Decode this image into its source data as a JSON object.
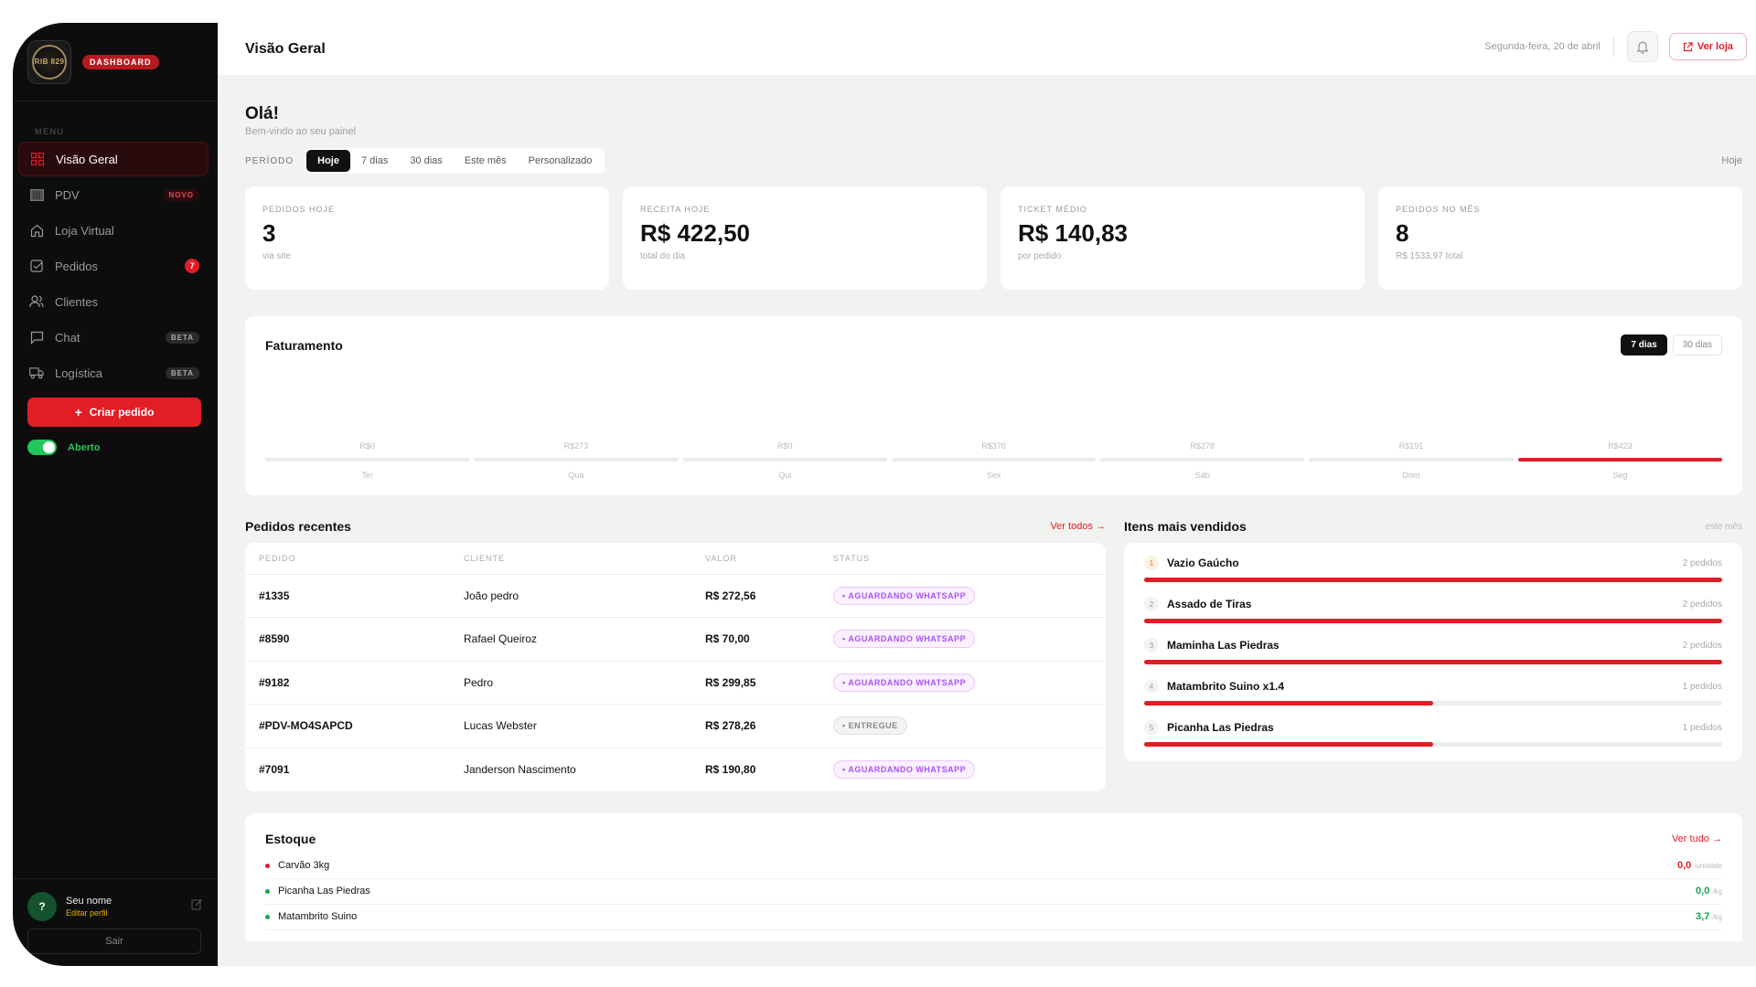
{
  "brand": {
    "logo_text": "RIB 829",
    "badge": "DASHBOARD"
  },
  "sidebar": {
    "menu_label": "MENU",
    "items": [
      {
        "label": "Visão Geral",
        "icon": "grid-icon",
        "active": true
      },
      {
        "label": "PDV",
        "icon": "register-icon",
        "badge": "NOVO"
      },
      {
        "label": "Loja Virtual",
        "icon": "home-icon"
      },
      {
        "label": "Pedidos",
        "icon": "checklist-icon",
        "count": "7"
      },
      {
        "label": "Clientes",
        "icon": "users-icon"
      },
      {
        "label": "Chat",
        "icon": "chat-icon",
        "badge": "BETA"
      },
      {
        "label": "Logística",
        "icon": "truck-icon",
        "badge": "BETA"
      }
    ],
    "create_order": "Criar pedido",
    "store_status": "Aberto",
    "user": {
      "avatar": "?",
      "name": "Seu nome",
      "edit": "Editar perfil"
    },
    "logout": "Sair"
  },
  "header": {
    "title": "Visão Geral",
    "date": "Segunda-feira, 20 de abril",
    "view_store": "Ver loja"
  },
  "greeting": {
    "title": "Olá!",
    "subtitle": "Bem-vindo ao seu painel"
  },
  "period": {
    "label": "PERÍODO",
    "options": [
      "Hoje",
      "7 dias",
      "30 dias",
      "Este mês",
      "Personalizado"
    ],
    "selected": "Hoje",
    "current": "Hoje"
  },
  "stats": [
    {
      "label": "PEDIDOS HOJE",
      "value": "3",
      "sub": "via site"
    },
    {
      "label": "RECEITA HOJE",
      "value": "R$ 422,50",
      "sub": "total do dia"
    },
    {
      "label": "TICKET MÉDIO",
      "value": "R$ 140,83",
      "sub": "por pedido"
    },
    {
      "label": "PEDIDOS NO MÊS",
      "value": "8",
      "sub": "R$ 1533,97 total"
    }
  ],
  "revenue": {
    "title": "Faturamento",
    "range_options": [
      "7 dias",
      "30 dias"
    ],
    "range_selected": "7 dias"
  },
  "chart_data": {
    "type": "bar",
    "categories": [
      "Ter",
      "Qua",
      "Qui",
      "Sex",
      "Sáb",
      "Dom",
      "Seg"
    ],
    "value_labels": [
      "R$0",
      "R$273",
      "R$0",
      "R$370",
      "R$278",
      "R$191",
      "R$423"
    ],
    "values": [
      0,
      273,
      0,
      370,
      278,
      191,
      423
    ],
    "highlight_color": "#e11d26",
    "highlight_index": 6,
    "title": "Faturamento"
  },
  "orders": {
    "title": "Pedidos recentes",
    "view_all": "Ver todos →",
    "columns": [
      "PEDIDO",
      "CLIENTE",
      "VALOR",
      "STATUS"
    ],
    "rows": [
      {
        "id": "#1335",
        "client": "João pedro",
        "value": "R$ 272,56",
        "status": "• AGUARDANDO WHATSAPP",
        "kind": "wait"
      },
      {
        "id": "#8590",
        "client": "Rafael Queiroz",
        "value": "R$ 70,00",
        "status": "• AGUARDANDO WHATSAPP",
        "kind": "wait"
      },
      {
        "id": "#9182",
        "client": "Pedro",
        "value": "R$ 299,85",
        "status": "• AGUARDANDO WHATSAPP",
        "kind": "wait"
      },
      {
        "id": "#PDV-MO4SAPCD",
        "client": "Lucas Webster",
        "value": "R$ 278,26",
        "status": "• ENTREGUE",
        "kind": "done"
      },
      {
        "id": "#7091",
        "client": "Janderson Nascimento",
        "value": "R$ 190,80",
        "status": "• AGUARDANDO WHATSAPP",
        "kind": "wait"
      }
    ]
  },
  "top_items": {
    "title": "Itens mais vendidos",
    "period": "este mês",
    "items": [
      {
        "rank": "1",
        "name": "Vazio Gaúcho",
        "count": "2 pedidos",
        "share": 1.0
      },
      {
        "rank": "2",
        "name": "Assado de Tiras",
        "count": "2 pedidos",
        "share": 1.0
      },
      {
        "rank": "3",
        "name": "Maminha Las Piedras",
        "count": "2 pedidos",
        "share": 1.0
      },
      {
        "rank": "4",
        "name": "Matambrito Suino x1.4",
        "count": "1 pedidos",
        "share": 0.5
      },
      {
        "rank": "5",
        "name": "Picanha Las Piedras",
        "count": "1 pedidos",
        "share": 0.5
      }
    ]
  },
  "stock": {
    "title": "Estoque",
    "view_all": "Ver tudo →",
    "items": [
      {
        "name": "Carvão 3kg",
        "qty": "0,0",
        "unit": "/unidade",
        "color": "#e11d26"
      },
      {
        "name": "Picanha Las Piedras",
        "qty": "0,0",
        "unit": "/kg",
        "color": "#16a34a"
      },
      {
        "name": "Matambrito Suino",
        "qty": "3,7",
        "unit": "/kg",
        "color": "#16a34a"
      }
    ]
  }
}
